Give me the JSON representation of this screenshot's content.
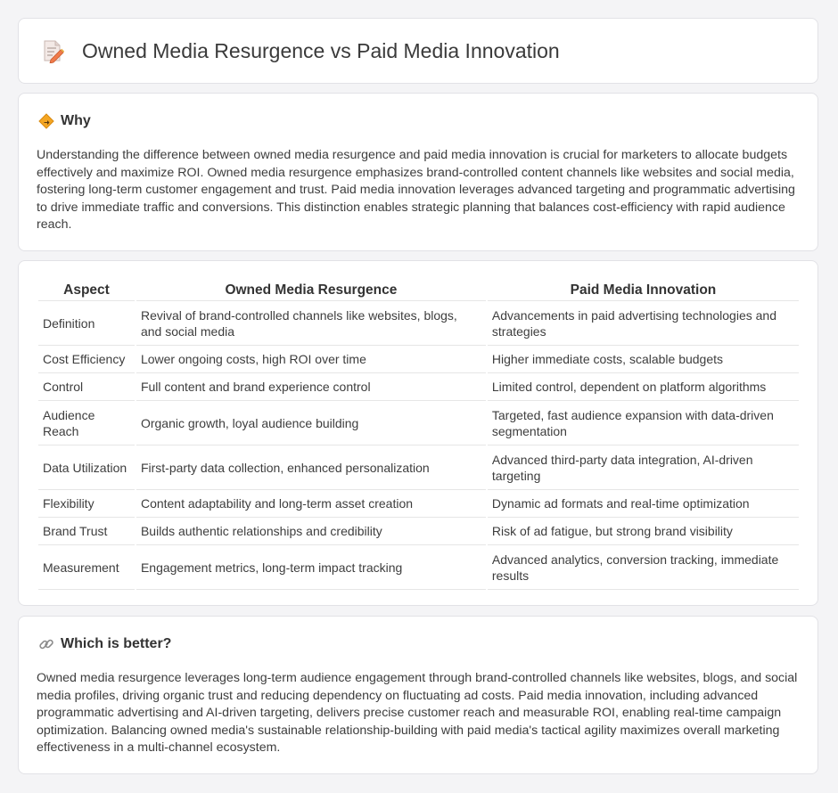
{
  "page": {
    "title": "Owned Media Resurgence vs Paid Media Innovation",
    "title_icon": "document-pencil-icon"
  },
  "why": {
    "heading": "Why",
    "icon": "diamond-sign-icon",
    "body": "Understanding the difference between owned media resurgence and paid media innovation is crucial for marketers to allocate budgets effectively and maximize ROI. Owned media resurgence emphasizes brand-controlled content channels like websites and social media, fostering long-term customer engagement and trust. Paid media innovation leverages advanced targeting and programmatic advertising to drive immediate traffic and conversions. This distinction enables strategic planning that balances cost-efficiency with rapid audience reach."
  },
  "table": {
    "headers": [
      "Aspect",
      "Owned Media Resurgence",
      "Paid Media Innovation"
    ],
    "rows": [
      [
        "Definition",
        "Revival of brand-controlled channels like websites, blogs, and social media",
        "Advancements in paid advertising technologies and strategies"
      ],
      [
        "Cost Efficiency",
        "Lower ongoing costs, high ROI over time",
        "Higher immediate costs, scalable budgets"
      ],
      [
        "Control",
        "Full content and brand experience control",
        "Limited control, dependent on platform algorithms"
      ],
      [
        "Audience Reach",
        "Organic growth, loyal audience building",
        "Targeted, fast audience expansion with data-driven segmentation"
      ],
      [
        "Data Utilization",
        "First-party data collection, enhanced personalization",
        "Advanced third-party data integration, AI-driven targeting"
      ],
      [
        "Flexibility",
        "Content adaptability and long-term asset creation",
        "Dynamic ad formats and real-time optimization"
      ],
      [
        "Brand Trust",
        "Builds authentic relationships and credibility",
        "Risk of ad fatigue, but strong brand visibility"
      ],
      [
        "Measurement",
        "Engagement metrics, long-term impact tracking",
        "Advanced analytics, conversion tracking, immediate results"
      ]
    ]
  },
  "better": {
    "heading": "Which is better?",
    "icon": "link-icon",
    "body": "Owned media resurgence leverages long-term audience engagement through brand-controlled channels like websites, blogs, and social media profiles, driving organic trust and reducing dependency on fluctuating ad costs. Paid media innovation, including advanced programmatic advertising and AI-driven targeting, delivers precise customer reach and measurable ROI, enabling real-time campaign optimization. Balancing owned media's sustainable relationship-building with paid media's tactical agility maximizes overall marketing effectiveness in a multi-channel ecosystem."
  }
}
